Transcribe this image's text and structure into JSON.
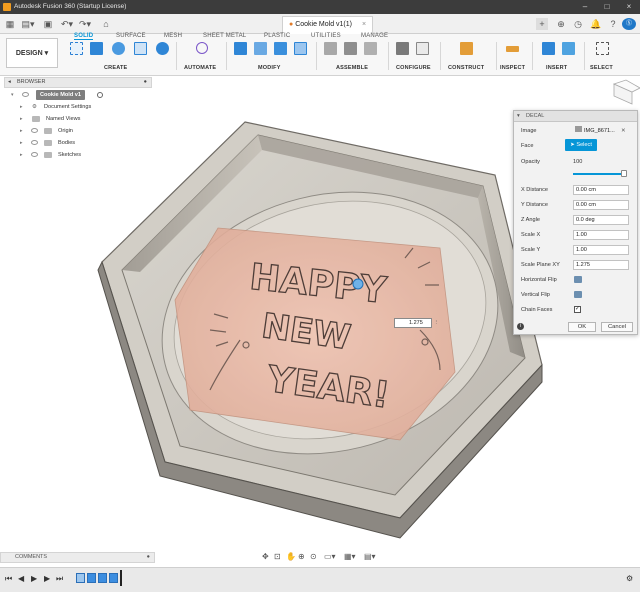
{
  "window": {
    "title": "Autodesk Fusion 360 (Startup License)"
  },
  "tabs": {
    "document": "Cookie Mold v1(1)"
  },
  "ribbon": {
    "workspace": "DESIGN",
    "tabs": [
      "SOLID",
      "SURFACE",
      "MESH",
      "SHEET METAL",
      "PLASTIC",
      "UTILITIES",
      "MANAGE"
    ],
    "groups": [
      "CREATE",
      "AUTOMATE",
      "MODIFY",
      "ASSEMBLE",
      "CONFIGURE",
      "CONSTRUCT",
      "INSPECT",
      "INSERT",
      "SELECT"
    ]
  },
  "browser": {
    "title": "BROWSER",
    "root": "Cookie Mold v1",
    "items": [
      "Document Settings",
      "Named Views",
      "Origin",
      "Bodies",
      "Sketches"
    ]
  },
  "decal": {
    "title": "DECAL",
    "image_label": "Image",
    "image_value": "IMG_8671...",
    "face_label": "Face",
    "select_label": "Select",
    "opacity_label": "Opacity",
    "opacity_value": "100",
    "opacity_fraction": 0.95,
    "x_label": "X Distance",
    "x_value": "0.00 cm",
    "y_label": "Y Distance",
    "y_value": "0.00 cm",
    "z_label": "Z Angle",
    "z_value": "0.0 deg",
    "sx_label": "Scale X",
    "sx_value": "1.00",
    "sy_label": "Scale Y",
    "sy_value": "1.00",
    "sxy_label": "Scale Plane XY",
    "sxy_value": "1.275",
    "hflip_label": "Horizontal Flip",
    "vflip_label": "Vertical Flip",
    "chain_label": "Chain Faces",
    "ok": "OK",
    "cancel": "Cancel"
  },
  "canvas": {
    "scale_value": "1.275",
    "decal_lines": [
      "HAPPY",
      "NEW",
      "YEAR!"
    ],
    "colors": {
      "mold": "#c9c5bd",
      "decal": "#e9b7a4",
      "accent": "#0696d7"
    }
  },
  "comments": {
    "label": "COMMENTS"
  }
}
